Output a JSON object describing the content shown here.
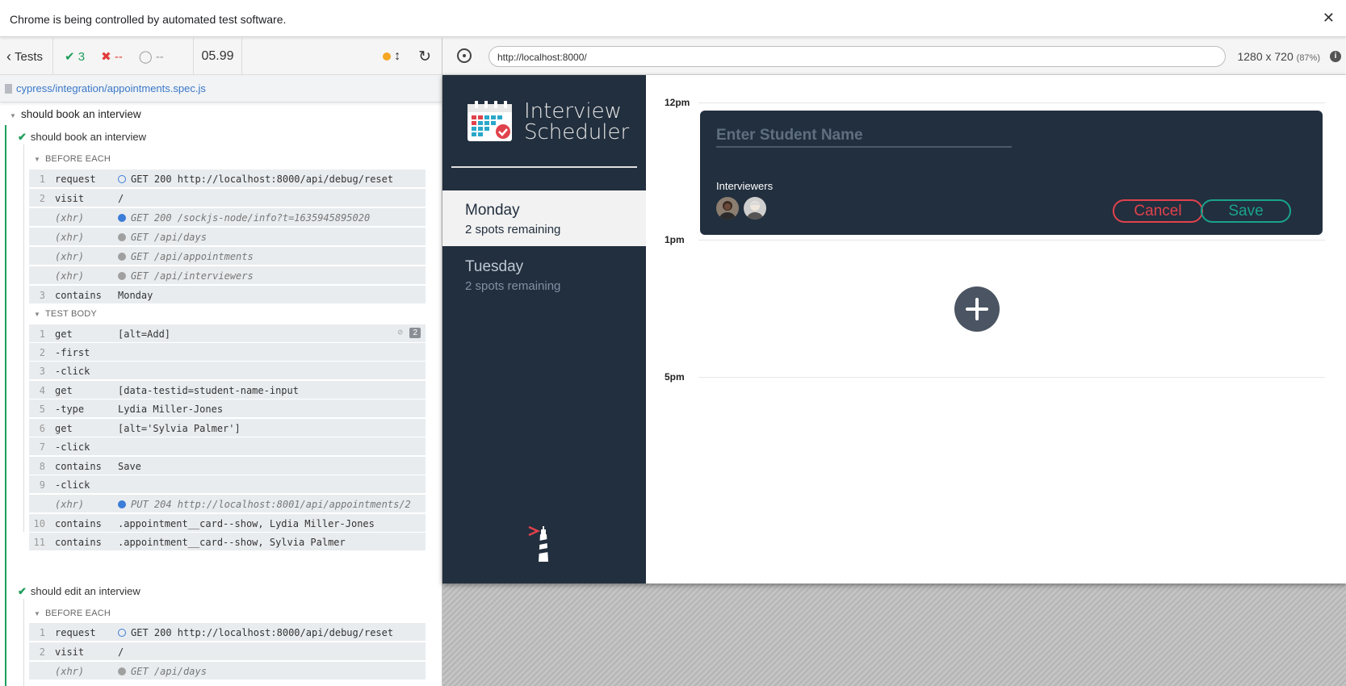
{
  "infobar": {
    "message": "Chrome is being controlled by automated test software.",
    "close": "✕"
  },
  "reporter": {
    "tests_label": "Tests",
    "passed": "3",
    "failed": "--",
    "pending": "--",
    "duration": "05.99",
    "spec_path": "cypress/integration/appointments.spec.js",
    "suite": "should book an interview",
    "test1": {
      "title": "should book an interview",
      "before_each_label": "BEFORE EACH",
      "before_each": [
        {
          "num": "1",
          "name": "request",
          "msg": "GET 200 http://localhost:8000/api/debug/reset"
        },
        {
          "num": "2",
          "name": "visit",
          "msg": "/"
        },
        {
          "num": "",
          "name": "(xhr)",
          "msg": "GET 200 /sockjs-node/info?t=1635945895020"
        },
        {
          "num": "",
          "name": "(xhr)",
          "msg": "GET /api/days"
        },
        {
          "num": "",
          "name": "(xhr)",
          "msg": "GET /api/appointments"
        },
        {
          "num": "",
          "name": "(xhr)",
          "msg": "GET /api/interviewers"
        },
        {
          "num": "3",
          "name": "contains",
          "msg": "Monday"
        }
      ],
      "test_body_label": "TEST BODY",
      "test_body": [
        {
          "num": "1",
          "name": "get",
          "msg": "[alt=Add]",
          "badge": "2"
        },
        {
          "num": "2",
          "name": "-first",
          "msg": ""
        },
        {
          "num": "3",
          "name": "-click",
          "msg": ""
        },
        {
          "num": "4",
          "name": "get",
          "msg": "[data-testid=student-name-input"
        },
        {
          "num": "5",
          "name": "-type",
          "msg": "Lydia Miller-Jones"
        },
        {
          "num": "6",
          "name": "get",
          "msg": "[alt='Sylvia Palmer']"
        },
        {
          "num": "7",
          "name": "-click",
          "msg": ""
        },
        {
          "num": "8",
          "name": "contains",
          "msg": "Save"
        },
        {
          "num": "9",
          "name": "-click",
          "msg": ""
        },
        {
          "num": "",
          "name": "(xhr)",
          "msg": "PUT 204 http://localhost:8001/api/appointments/2"
        },
        {
          "num": "10",
          "name": "contains",
          "msg": ".appointment__card--show, Lydia Miller-Jones"
        },
        {
          "num": "11",
          "name": "contains",
          "msg": ".appointment__card--show, Sylvia Palmer"
        }
      ]
    },
    "test2": {
      "title": "should edit an interview",
      "before_each_label": "BEFORE EACH",
      "before_each": [
        {
          "num": "1",
          "name": "request",
          "msg": "GET 200 http://localhost:8000/api/debug/reset"
        },
        {
          "num": "2",
          "name": "visit",
          "msg": "/"
        },
        {
          "num": "",
          "name": "(xhr)",
          "msg": "GET /api/days"
        }
      ]
    }
  },
  "aut": {
    "url": "http://localhost:8000/",
    "viewport": "1280 x 720",
    "zoom": "(87%)",
    "info": "i"
  },
  "app": {
    "logo_line1": "Interview",
    "logo_line2": "Scheduler",
    "days": [
      {
        "name": "Monday",
        "spots": "2 spots remaining"
      },
      {
        "name": "Tuesday",
        "spots": "2 spots remaining"
      }
    ],
    "times": [
      "12pm",
      "1pm",
      "5pm"
    ],
    "form": {
      "placeholder": "Enter Student Name",
      "interviewers_label": "Interviewers",
      "cancel": "Cancel",
      "save": "Save"
    }
  }
}
